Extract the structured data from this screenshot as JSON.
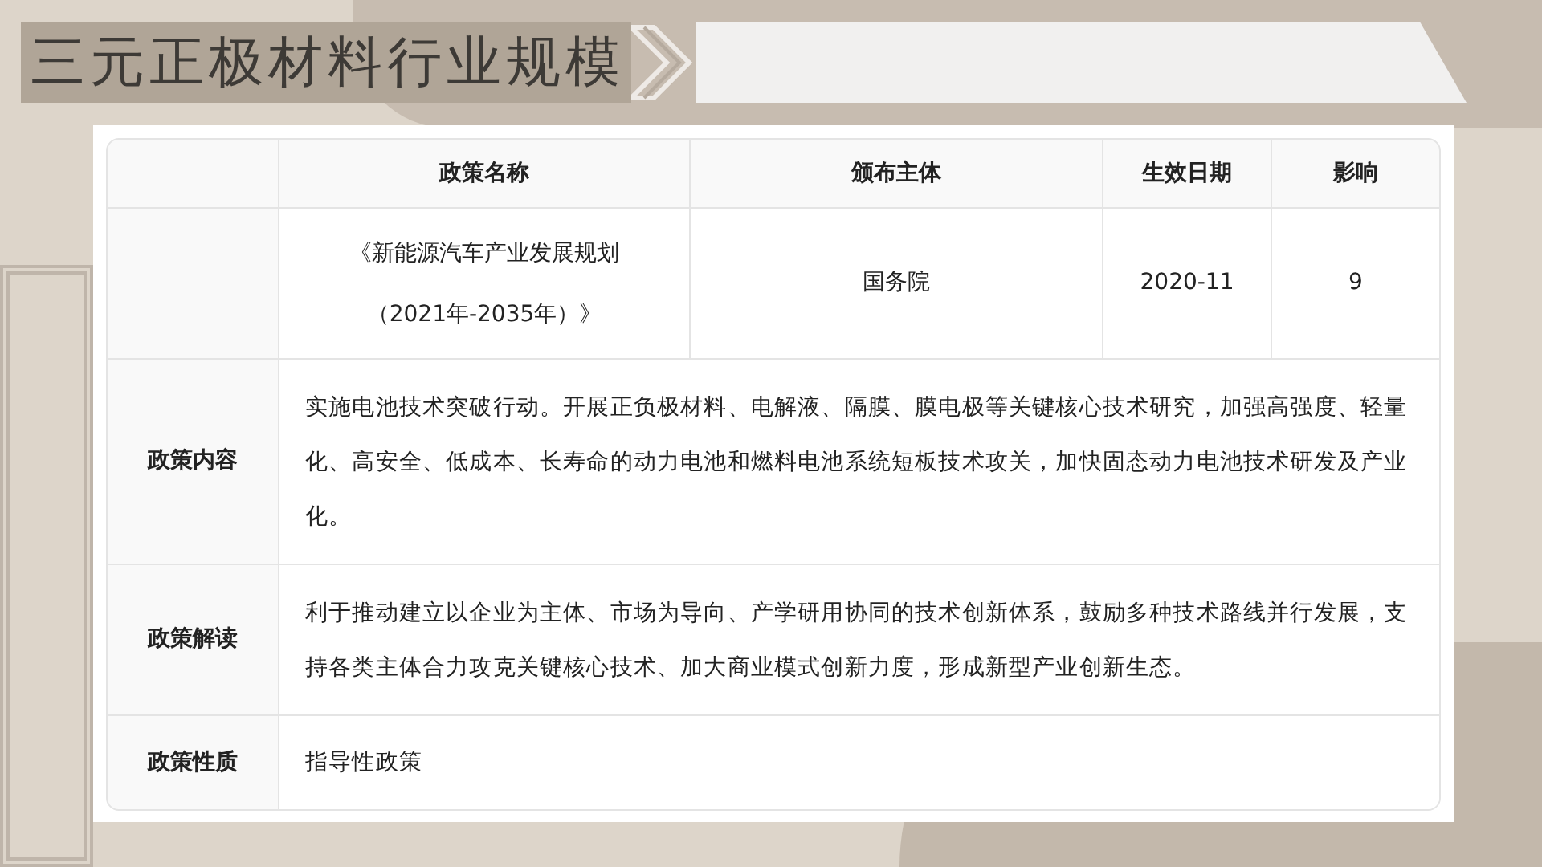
{
  "title": "三元正极材料行业规模",
  "table": {
    "columns": [
      "政策名称",
      "颁布主体",
      "生效日期",
      "影响"
    ],
    "policy_name_lines": [
      "《新能源汽车产业发展规划",
      "（2021年-2035年）》"
    ],
    "row": [
      "国务院",
      "2020-11",
      "9"
    ],
    "details": [
      {
        "label": "政策内容",
        "text": "实施电池技术突破行动。开展正负极材料、电解液、隔膜、膜电极等关键核心技术研究，加强高强度、轻量化、高安全、低成本、长寿命的动力电池和燃料电池系统短板技术攻关，加快固态动力电池技术研发及产业化。"
      },
      {
        "label": "政策解读",
        "text": "利于推动建立以企业为主体、市场为导向、产学研用协同的技术创新体系，鼓励多种技术路线并行发展，支持各类主体合力攻克关键核心技术、加大商业模式创新力度，形成新型产业创新生态。"
      },
      {
        "label": "政策性质",
        "text": "指导性政策"
      }
    ]
  }
}
